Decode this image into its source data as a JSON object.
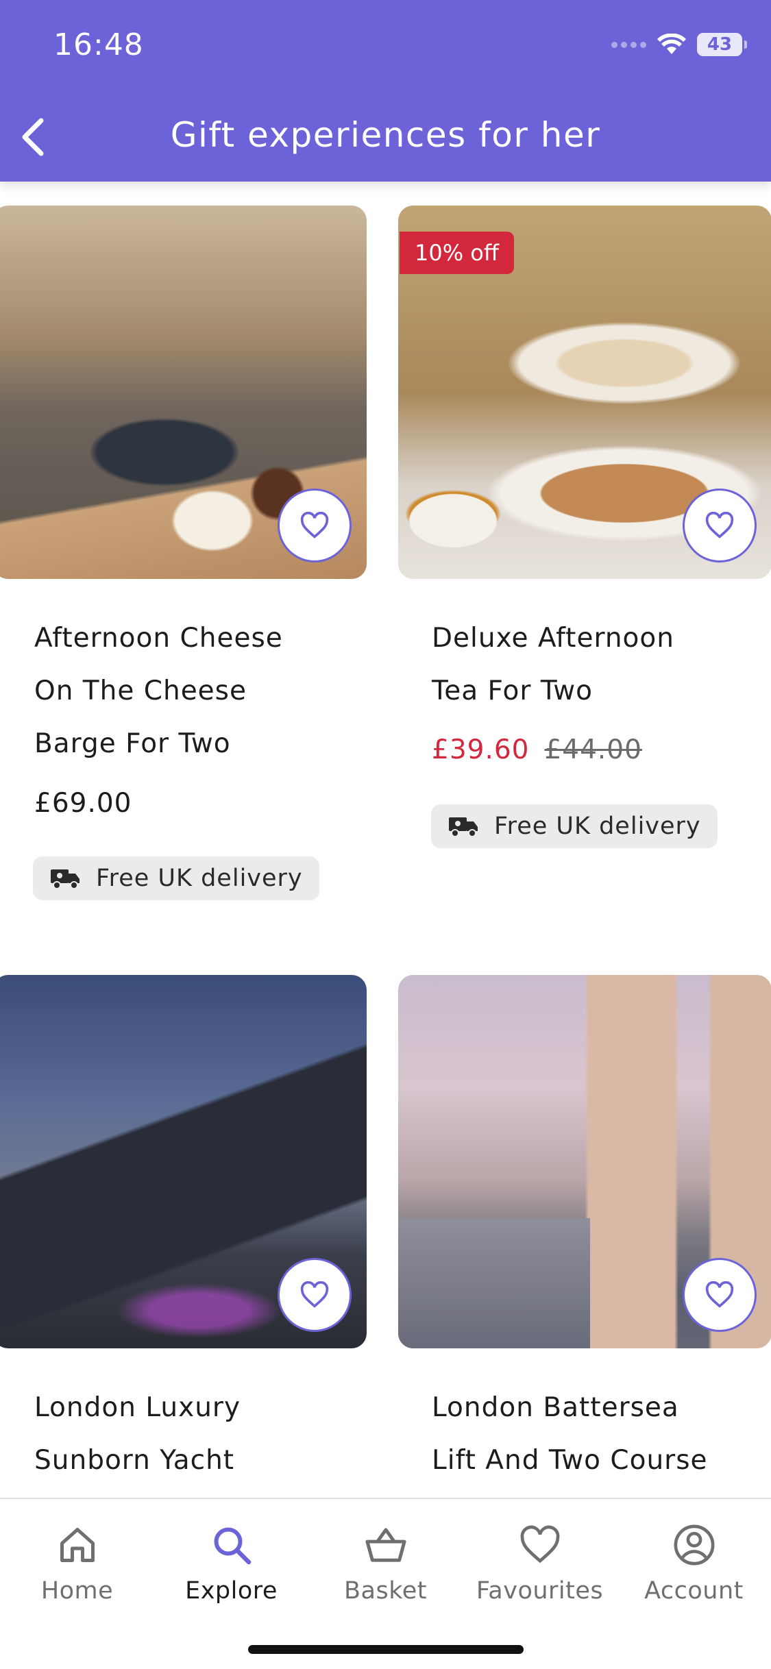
{
  "status_bar": {
    "time": "16:48",
    "battery": "43"
  },
  "header": {
    "title": "Gift experiences for her",
    "back_icon": "chevron-left-icon"
  },
  "colors": {
    "brand": "#6d63d9",
    "sale": "#d3273c",
    "chip_bg": "#ebebeb"
  },
  "products": [
    {
      "title_lines": [
        "Afternoon Cheese",
        "On The Cheese",
        "Barge For Two"
      ],
      "price": "£69.00",
      "delivery": "Free UK delivery",
      "image": "cheese-board-photo"
    },
    {
      "badge": "10% off",
      "title_lines": [
        "Deluxe Afternoon",
        "Tea For Two"
      ],
      "sale_price": "£39.60",
      "original_price": "£44.00",
      "delivery": "Free UK delivery",
      "image": "afternoon-tea-photo"
    },
    {
      "title_lines": [
        "London Luxury",
        "Sunborn Yacht"
      ],
      "image": "yacht-hotel-photo"
    },
    {
      "title_lines": [
        "London Battersea",
        "Lift And Two Course"
      ],
      "image": "battersea-chimney-photo"
    }
  ],
  "tabbar": {
    "items": [
      {
        "label": "Home",
        "icon": "home-icon",
        "active": false
      },
      {
        "label": "Explore",
        "icon": "search-icon",
        "active": true
      },
      {
        "label": "Basket",
        "icon": "basket-icon",
        "active": false
      },
      {
        "label": "Favourites",
        "icon": "heart-icon",
        "active": false
      },
      {
        "label": "Account",
        "icon": "account-icon",
        "active": false
      }
    ]
  }
}
